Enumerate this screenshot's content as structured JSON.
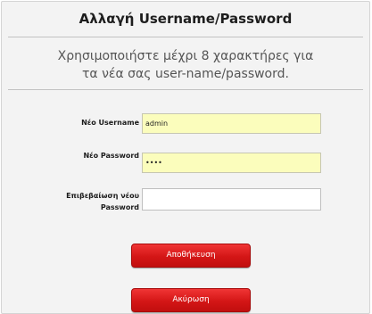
{
  "dialog": {
    "title": "Αλλαγή Username/Password",
    "instructions": {
      "line1": "Χρησιμοποιήστε μέχρι 8 χαρακτήρες για",
      "line2": "τα νέα σας user-name/password."
    }
  },
  "form": {
    "username": {
      "label": "Νέο Username",
      "value": "admin"
    },
    "password": {
      "label": "Νέο Password",
      "value": "••••"
    },
    "confirm": {
      "label_line1": "Επιβεβαίωση νέου",
      "label_line2": "Password",
      "value": ""
    }
  },
  "buttons": {
    "save_label": "Αποθήκευση",
    "cancel_label": "Ακύρωση"
  },
  "colors": {
    "input_highlight": "#fbfdbc",
    "button_red": "#d41616",
    "panel_bg": "#f3f3f3"
  }
}
